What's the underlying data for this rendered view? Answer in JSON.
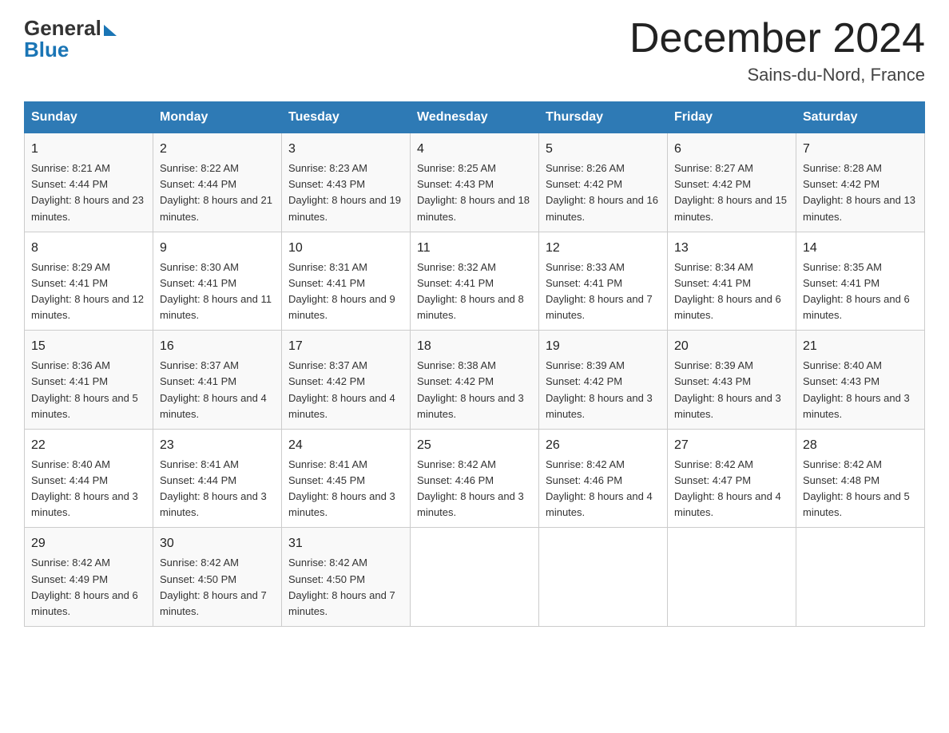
{
  "header": {
    "month_title": "December 2024",
    "location": "Sains-du-Nord, France",
    "logo_general": "General",
    "logo_blue": "Blue"
  },
  "days_of_week": [
    "Sunday",
    "Monday",
    "Tuesday",
    "Wednesday",
    "Thursday",
    "Friday",
    "Saturday"
  ],
  "weeks": [
    [
      {
        "day": "1",
        "sunrise": "8:21 AM",
        "sunset": "4:44 PM",
        "daylight": "8 hours and 23 minutes."
      },
      {
        "day": "2",
        "sunrise": "8:22 AM",
        "sunset": "4:44 PM",
        "daylight": "8 hours and 21 minutes."
      },
      {
        "day": "3",
        "sunrise": "8:23 AM",
        "sunset": "4:43 PM",
        "daylight": "8 hours and 19 minutes."
      },
      {
        "day": "4",
        "sunrise": "8:25 AM",
        "sunset": "4:43 PM",
        "daylight": "8 hours and 18 minutes."
      },
      {
        "day": "5",
        "sunrise": "8:26 AM",
        "sunset": "4:42 PM",
        "daylight": "8 hours and 16 minutes."
      },
      {
        "day": "6",
        "sunrise": "8:27 AM",
        "sunset": "4:42 PM",
        "daylight": "8 hours and 15 minutes."
      },
      {
        "day": "7",
        "sunrise": "8:28 AM",
        "sunset": "4:42 PM",
        "daylight": "8 hours and 13 minutes."
      }
    ],
    [
      {
        "day": "8",
        "sunrise": "8:29 AM",
        "sunset": "4:41 PM",
        "daylight": "8 hours and 12 minutes."
      },
      {
        "day": "9",
        "sunrise": "8:30 AM",
        "sunset": "4:41 PM",
        "daylight": "8 hours and 11 minutes."
      },
      {
        "day": "10",
        "sunrise": "8:31 AM",
        "sunset": "4:41 PM",
        "daylight": "8 hours and 9 minutes."
      },
      {
        "day": "11",
        "sunrise": "8:32 AM",
        "sunset": "4:41 PM",
        "daylight": "8 hours and 8 minutes."
      },
      {
        "day": "12",
        "sunrise": "8:33 AM",
        "sunset": "4:41 PM",
        "daylight": "8 hours and 7 minutes."
      },
      {
        "day": "13",
        "sunrise": "8:34 AM",
        "sunset": "4:41 PM",
        "daylight": "8 hours and 6 minutes."
      },
      {
        "day": "14",
        "sunrise": "8:35 AM",
        "sunset": "4:41 PM",
        "daylight": "8 hours and 6 minutes."
      }
    ],
    [
      {
        "day": "15",
        "sunrise": "8:36 AM",
        "sunset": "4:41 PM",
        "daylight": "8 hours and 5 minutes."
      },
      {
        "day": "16",
        "sunrise": "8:37 AM",
        "sunset": "4:41 PM",
        "daylight": "8 hours and 4 minutes."
      },
      {
        "day": "17",
        "sunrise": "8:37 AM",
        "sunset": "4:42 PM",
        "daylight": "8 hours and 4 minutes."
      },
      {
        "day": "18",
        "sunrise": "8:38 AM",
        "sunset": "4:42 PM",
        "daylight": "8 hours and 3 minutes."
      },
      {
        "day": "19",
        "sunrise": "8:39 AM",
        "sunset": "4:42 PM",
        "daylight": "8 hours and 3 minutes."
      },
      {
        "day": "20",
        "sunrise": "8:39 AM",
        "sunset": "4:43 PM",
        "daylight": "8 hours and 3 minutes."
      },
      {
        "day": "21",
        "sunrise": "8:40 AM",
        "sunset": "4:43 PM",
        "daylight": "8 hours and 3 minutes."
      }
    ],
    [
      {
        "day": "22",
        "sunrise": "8:40 AM",
        "sunset": "4:44 PM",
        "daylight": "8 hours and 3 minutes."
      },
      {
        "day": "23",
        "sunrise": "8:41 AM",
        "sunset": "4:44 PM",
        "daylight": "8 hours and 3 minutes."
      },
      {
        "day": "24",
        "sunrise": "8:41 AM",
        "sunset": "4:45 PM",
        "daylight": "8 hours and 3 minutes."
      },
      {
        "day": "25",
        "sunrise": "8:42 AM",
        "sunset": "4:46 PM",
        "daylight": "8 hours and 3 minutes."
      },
      {
        "day": "26",
        "sunrise": "8:42 AM",
        "sunset": "4:46 PM",
        "daylight": "8 hours and 4 minutes."
      },
      {
        "day": "27",
        "sunrise": "8:42 AM",
        "sunset": "4:47 PM",
        "daylight": "8 hours and 4 minutes."
      },
      {
        "day": "28",
        "sunrise": "8:42 AM",
        "sunset": "4:48 PM",
        "daylight": "8 hours and 5 minutes."
      }
    ],
    [
      {
        "day": "29",
        "sunrise": "8:42 AM",
        "sunset": "4:49 PM",
        "daylight": "8 hours and 6 minutes."
      },
      {
        "day": "30",
        "sunrise": "8:42 AM",
        "sunset": "4:50 PM",
        "daylight": "8 hours and 7 minutes."
      },
      {
        "day": "31",
        "sunrise": "8:42 AM",
        "sunset": "4:50 PM",
        "daylight": "8 hours and 7 minutes."
      },
      null,
      null,
      null,
      null
    ]
  ]
}
